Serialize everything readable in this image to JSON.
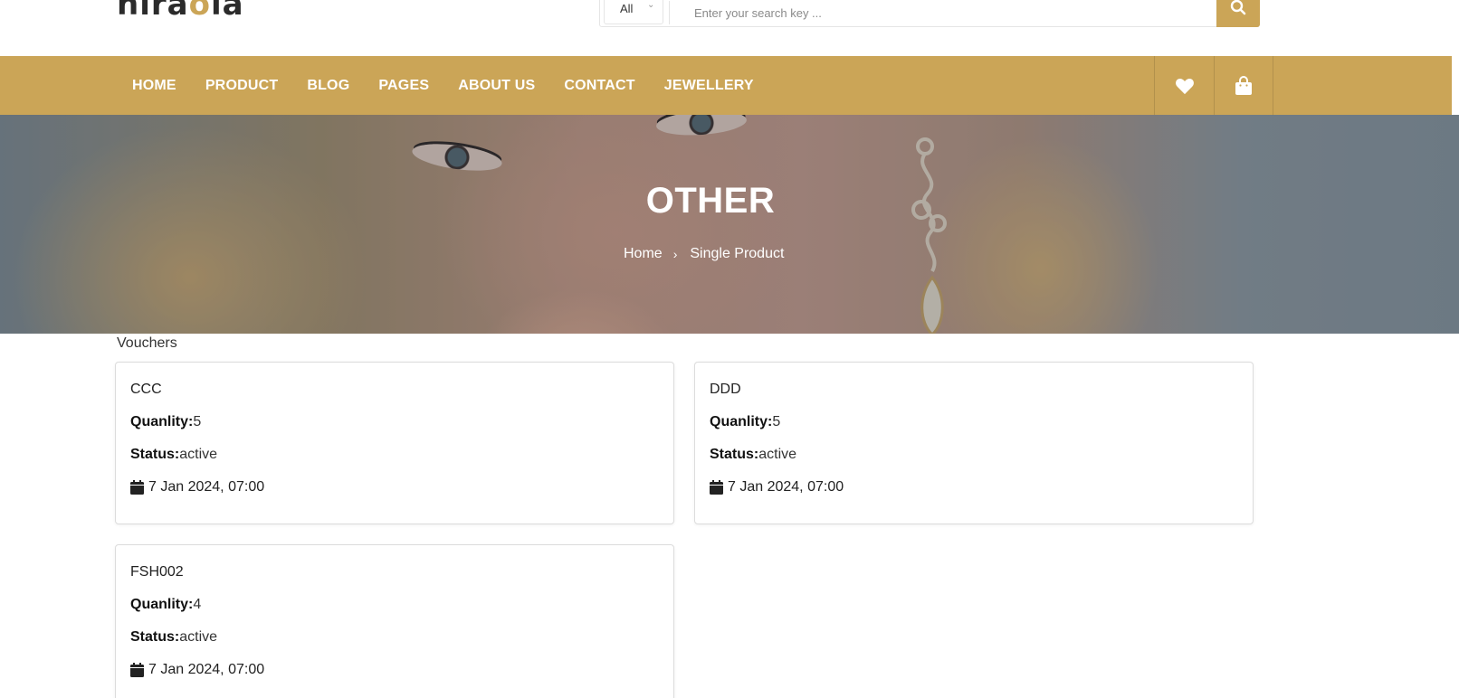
{
  "header": {
    "logo_prefix": "hira",
    "logo_o": "o",
    "logo_suffix": "la",
    "search": {
      "category": "All",
      "placeholder": "Enter your search key ..."
    }
  },
  "nav": {
    "items": [
      "HOME",
      "PRODUCT",
      "BLOG",
      "PAGES",
      "ABOUT US",
      "CONTACT",
      "JEWELLERY"
    ],
    "icons": [
      "heart-icon",
      "shopping-bag-icon"
    ]
  },
  "hero": {
    "title": "OTHER",
    "breadcrumb": {
      "home": "Home",
      "separator": "›",
      "current": "Single Product"
    }
  },
  "vouchers": {
    "title": "Vouchers",
    "quantity_label": "Quanlity:",
    "status_label": "Status:",
    "items": [
      {
        "code": "CCC",
        "quantity": "5",
        "status": "active",
        "date": "7 Jan 2024, 07:00"
      },
      {
        "code": "DDD",
        "quantity": "5",
        "status": "active",
        "date": "7 Jan 2024, 07:00"
      },
      {
        "code": "FSH002",
        "quantity": "4",
        "status": "active",
        "date": "7 Jan 2024, 07:00"
      }
    ]
  },
  "colors": {
    "accent": "#cba557",
    "text": "#333333",
    "white": "#ffffff"
  }
}
